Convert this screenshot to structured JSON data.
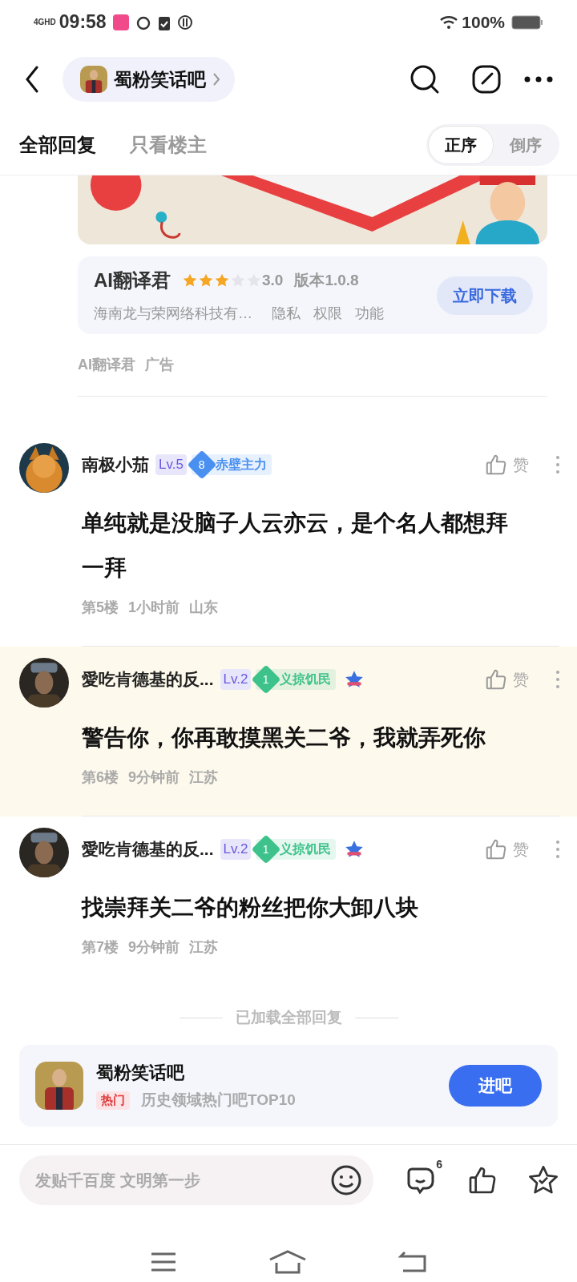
{
  "status_bar": {
    "network": "4GHD",
    "time": "09:58",
    "battery": "100%"
  },
  "nav": {
    "forum": "蜀粉笑话吧"
  },
  "tabs": [
    {
      "label": "全部回复",
      "selected": true
    },
    {
      "label": "只看楼主",
      "selected": false
    }
  ],
  "sort": [
    {
      "label": "正序",
      "selected": true
    },
    {
      "label": "倒序",
      "selected": false
    }
  ],
  "ad": {
    "app_name": "AI翻译君",
    "stars": 3,
    "rating": "3.0",
    "version": "版本1.0.8",
    "developer": "海南龙与荣网络科技有…",
    "links": [
      "隐私",
      "权限",
      "功能"
    ],
    "button": "立即下载",
    "source": "AI翻译君",
    "tag": "广告"
  },
  "comments": [
    {
      "user": "南极小茄",
      "level": "Lv.5",
      "badge_number": "8",
      "badge": "赤壁主力",
      "color": "#4a90f0",
      "medal": false,
      "highlighted": false,
      "like": "赞",
      "text": "单纯就是没脑子人云亦云，是个名人都想拜一拜",
      "floor": "第5楼",
      "time": "1小时前",
      "location": "山东"
    },
    {
      "user": "愛吃肯德基的反...",
      "level": "Lv.2",
      "badge_number": "1",
      "badge": "义掠饥民",
      "color": "#3cc28a",
      "medal": true,
      "highlighted": true,
      "like": "赞",
      "text": "警告你，你再敢摸黑关二爷，我就弄死你",
      "floor": "第6楼",
      "time": "9分钟前",
      "location": "江苏"
    },
    {
      "user": "愛吃肯德基的反...",
      "level": "Lv.2",
      "badge_number": "1",
      "badge": "义掠饥民",
      "color": "#3cc28a",
      "medal": true,
      "highlighted": false,
      "like": "赞",
      "text": "找崇拜关二爷的粉丝把你大卸八块",
      "floor": "第7楼",
      "time": "9分钟前",
      "location": "江苏"
    }
  ],
  "end_note": "已加载全部回复",
  "forum_card": {
    "name": "蜀粉笑话吧",
    "tag": "热门",
    "description": "历史领域热门吧TOP10",
    "button": "进吧"
  },
  "bottom_bar": {
    "placeholder": "发贴千百度 文明第一步",
    "comment_count": "6"
  }
}
